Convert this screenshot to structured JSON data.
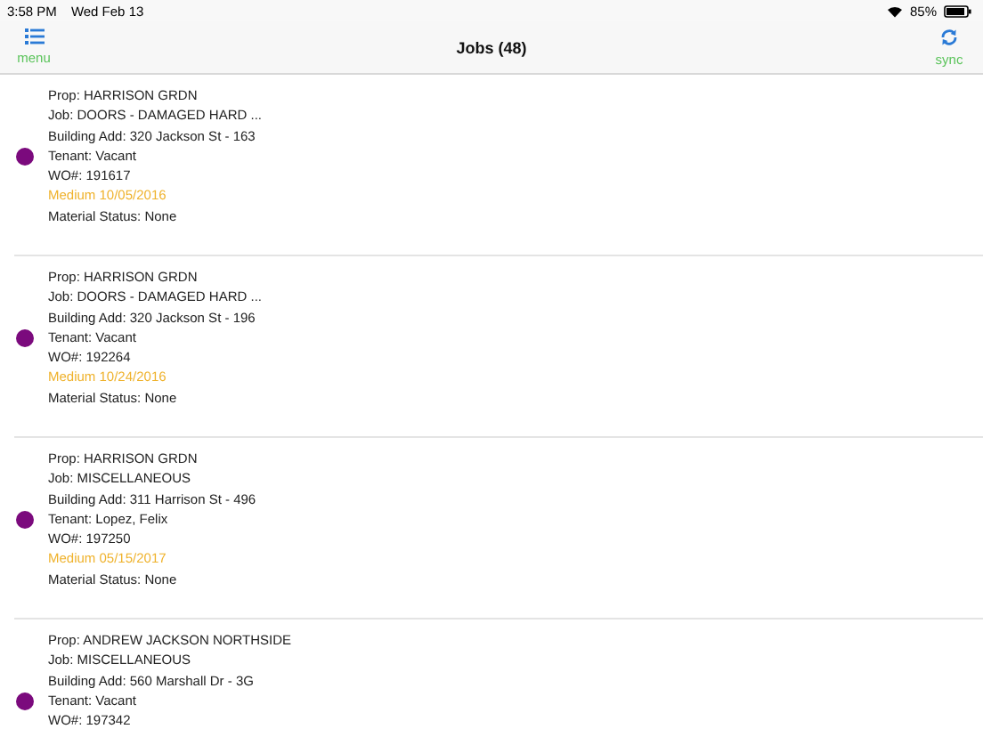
{
  "status_bar": {
    "time": "3:58 PM",
    "date": "Wed Feb 13",
    "battery": "85%"
  },
  "nav_bar": {
    "title": "Jobs (48)",
    "left_button": "menu",
    "right_button": "sync"
  },
  "jobs": [
    {
      "color": "#7b0a7d",
      "lines": [
        "Prop: HARRISON GRDN",
        "Job: DOORS - DAMAGED HARD ...",
        "Building Add: 320 Jackson St - 163",
        "Tenant: Vacant",
        "WO#: 191617"
      ],
      "priority_date": "Medium 10/05/2016",
      "material_status": "Material Status: None"
    },
    {
      "color": "#7b0a7d",
      "lines": [
        "Prop: HARRISON GRDN",
        "Job: DOORS - DAMAGED HARD ...",
        "Building Add: 320 Jackson St - 196",
        "Tenant: Vacant",
        "WO#: 192264"
      ],
      "priority_date": "Medium 10/24/2016",
      "material_status": "Material Status: None"
    },
    {
      "color": "#7b0a7d",
      "lines": [
        "Prop: HARRISON GRDN",
        "Job: MISCELLANEOUS",
        "Building Add: 311 Harrison St - 496",
        "Tenant: Lopez, Felix",
        "WO#: 197250"
      ],
      "priority_date": "Medium 05/15/2017",
      "material_status": "Material Status: None"
    },
    {
      "color": "#7b0a7d",
      "lines": [
        "Prop: ANDREW JACKSON NORTHSIDE",
        "Job: MISCELLANEOUS",
        "Building Add: 560 Marshall Dr - 3G",
        "Tenant: Vacant",
        "WO#: 197342"
      ]
    }
  ]
}
